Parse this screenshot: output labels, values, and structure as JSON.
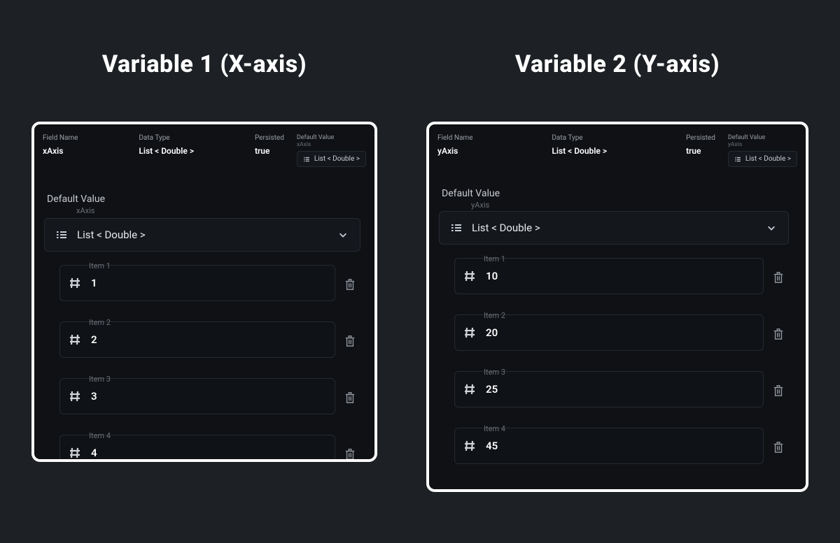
{
  "columns": [
    {
      "title": "Variable 1 (X-axis)",
      "summary": {
        "field_name_label": "Field Name",
        "field_name_value": "xAxis",
        "data_type_label": "Data Type",
        "data_type_value": "List < Double >",
        "persisted_label": "Persisted",
        "persisted_value": "true",
        "mini_default_label": "Default Value",
        "mini_default_sub": "xAxis",
        "mini_pill_text": "List < Double >"
      },
      "default_value": {
        "section_title": "Default Value",
        "section_sub": "xAxis",
        "list_type_text": "List < Double >",
        "items": [
          {
            "caption": "Item 1",
            "value": "1"
          },
          {
            "caption": "Item 2",
            "value": "2"
          },
          {
            "caption": "Item 3",
            "value": "3"
          },
          {
            "caption": "Item 4",
            "value": "4"
          }
        ]
      }
    },
    {
      "title": "Variable 2 (Y-axis)",
      "summary": {
        "field_name_label": "Field Name",
        "field_name_value": "yAxis",
        "data_type_label": "Data Type",
        "data_type_value": "List < Double >",
        "persisted_label": "Persisted",
        "persisted_value": "true",
        "mini_default_label": "Default Value",
        "mini_default_sub": "yAxis",
        "mini_pill_text": "List < Double >"
      },
      "default_value": {
        "section_title": "Default Value",
        "section_sub": "yAxis",
        "list_type_text": "List < Double >",
        "items": [
          {
            "caption": "Item 1",
            "value": "10"
          },
          {
            "caption": "Item 2",
            "value": "20"
          },
          {
            "caption": "Item 3",
            "value": "25"
          },
          {
            "caption": "Item 4",
            "value": "45"
          }
        ]
      }
    }
  ]
}
